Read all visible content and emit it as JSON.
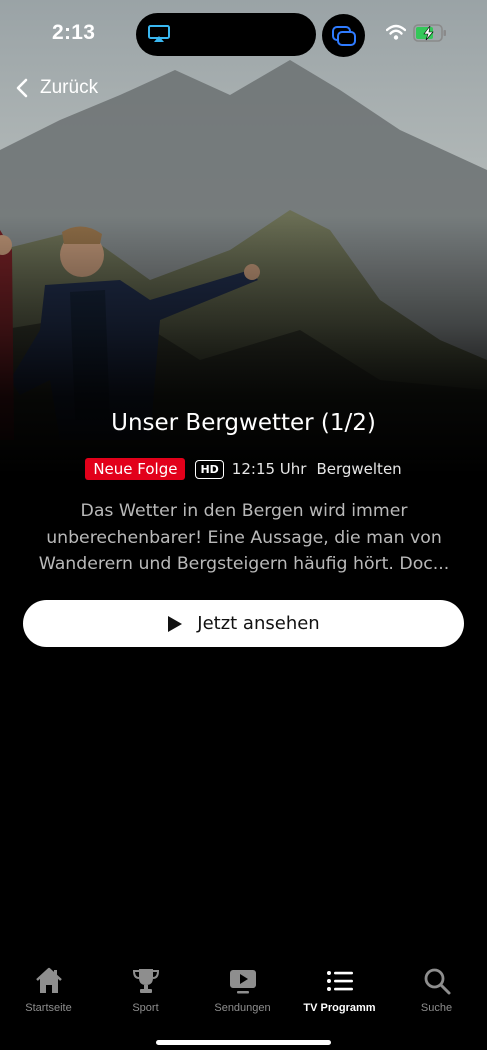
{
  "status_bar": {
    "time": "2:13",
    "icons": [
      "airplay-icon",
      "screen-share-icon",
      "wifi-icon",
      "battery-charging-icon"
    ],
    "battery_color": "#34c759"
  },
  "nav": {
    "back_label": "Zurück",
    "back_icon": "chevron-left-icon"
  },
  "episode": {
    "title": "Unser Bergwetter (1/2)",
    "badge_new": "Neue Folge",
    "badge_new_color": "#e2001a",
    "badge_quality": "HD",
    "time": "12:15 Uhr",
    "channel": "Bergwelten",
    "description": "Das Wetter in den Bergen wird immer unberechenbarer! Eine Aussage, die man von Wanderern und Bergsteigern häufig hört. Doc..."
  },
  "actions": {
    "watch_label": "Jetzt ansehen",
    "watch_icon": "play-icon"
  },
  "tab_bar": {
    "tabs": [
      {
        "label": "Startseite",
        "icon": "home-icon",
        "active": false
      },
      {
        "label": "Sport",
        "icon": "trophy-icon",
        "active": false
      },
      {
        "label": "Sendungen",
        "icon": "play-screen-icon",
        "active": false
      },
      {
        "label": "TV Programm",
        "icon": "list-icon",
        "active": true
      },
      {
        "label": "Suche",
        "icon": "search-icon",
        "active": false
      }
    ]
  }
}
